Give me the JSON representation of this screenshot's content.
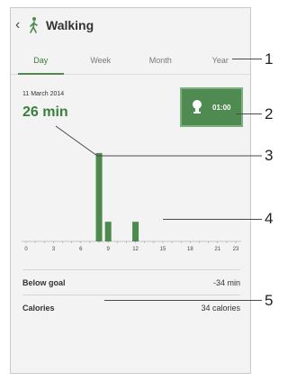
{
  "header": {
    "back_glyph": "‹",
    "title": "Walking",
    "icon": "walking-person-icon"
  },
  "tabs": [
    {
      "label": "Day",
      "active": true
    },
    {
      "label": "Week",
      "active": false
    },
    {
      "label": "Month",
      "active": false
    },
    {
      "label": "Year",
      "active": false
    }
  ],
  "summary": {
    "date": "11 March 2014",
    "minutes": "26 min",
    "goal_time": "01:00",
    "goal_icon": "trophy-icon"
  },
  "chart_data": {
    "type": "bar",
    "x_ticks": [
      "0",
      "3",
      "6",
      "9",
      "12",
      "15",
      "18",
      "21",
      "23"
    ],
    "x": [
      8,
      9,
      12
    ],
    "values": [
      18,
      4,
      4
    ],
    "ylim": [
      0,
      20
    ],
    "color": "#4c8a4e",
    "grid": false
  },
  "stats": [
    {
      "label": "Below goal",
      "value": "-34 min"
    },
    {
      "label": "Calories",
      "value": "34 calories"
    }
  ],
  "callouts": [
    "1",
    "2",
    "3",
    "4",
    "5"
  ],
  "colors": {
    "accent": "#4c8a4e",
    "goal_bg": "#4f8b50"
  }
}
